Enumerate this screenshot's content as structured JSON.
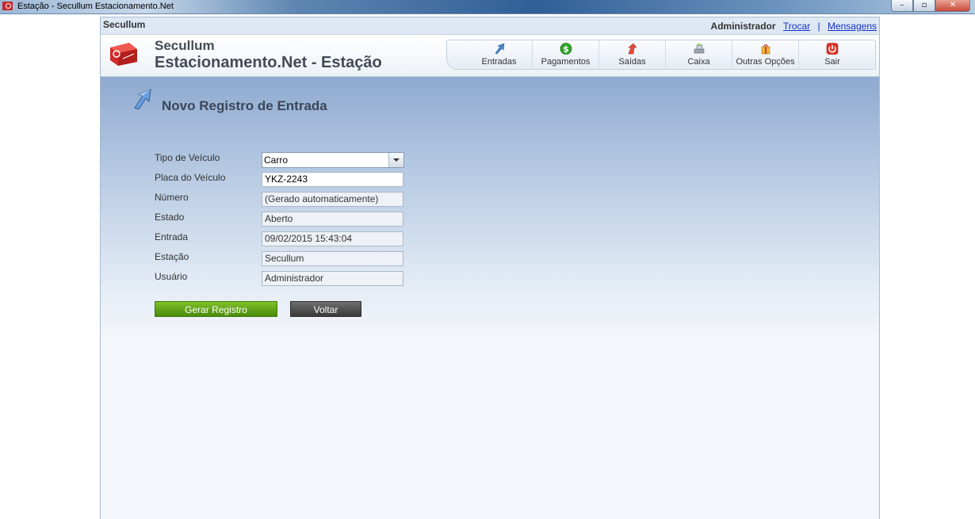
{
  "window": {
    "title": "Estação - Secullum Estacionamento.Net"
  },
  "topbar": {
    "brand": "Secullum",
    "user": "Administrador",
    "switch_link": "Trocar",
    "separator": "|",
    "messages_link": "Mensagens"
  },
  "header": {
    "title_line1": "Secullum",
    "title_line2": "Estacionamento.Net - Estação"
  },
  "nav": {
    "items": [
      {
        "label": "Entradas",
        "icon": "arrow-entry-icon"
      },
      {
        "label": "Pagamentos",
        "icon": "dollar-coin-icon"
      },
      {
        "label": "Saídas",
        "icon": "arrow-exit-icon"
      },
      {
        "label": "Caixa",
        "icon": "cash-register-icon"
      },
      {
        "label": "Outras Opções",
        "icon": "package-icon"
      },
      {
        "label": "Sair",
        "icon": "power-icon"
      }
    ]
  },
  "page": {
    "title": "Novo Registro de Entrada"
  },
  "form": {
    "vehicle_type": {
      "label": "Tipo de Veículo",
      "value": "Carro"
    },
    "plate": {
      "label": "Placa do Veículo",
      "value": "YKZ-2243"
    },
    "number": {
      "label": "Número",
      "value": "(Gerado automaticamente)"
    },
    "state": {
      "label": "Estado",
      "value": "Aberto"
    },
    "entry": {
      "label": "Entrada",
      "value": "09/02/2015 15:43:04"
    },
    "station": {
      "label": "Estação",
      "value": "Secullum"
    },
    "user": {
      "label": "Usuário",
      "value": "Administrador"
    }
  },
  "buttons": {
    "generate": "Gerar Registro",
    "back": "Voltar"
  },
  "colors": {
    "primary_button": "#5a9c12",
    "secondary_button": "#4a4a4a",
    "content_gradient_top": "#8faad0",
    "logo_red": "#d32a2a"
  }
}
